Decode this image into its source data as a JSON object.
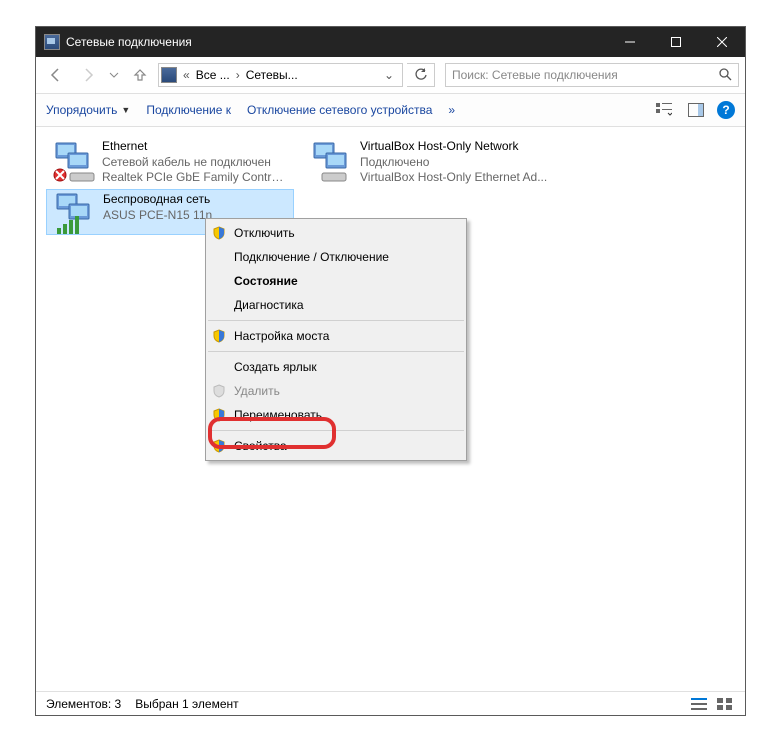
{
  "window": {
    "title": "Сетевые подключения",
    "breadcrumb": {
      "seg1": "Все ...",
      "seg2": "Сетевы..."
    },
    "search_placeholder": "Поиск: Сетевые подключения"
  },
  "toolbar": {
    "organize": "Упорядочить",
    "connect": "Подключение к",
    "disable": "Отключение сетевого устройства",
    "more": "»"
  },
  "adapters": {
    "ethernet": {
      "name": "Ethernet",
      "status": "Сетевой кабель не подключен",
      "device": "Realtek PCIe GbE Family Controller"
    },
    "virtualbox": {
      "name": "VirtualBox Host-Only Network",
      "status": "Подключено",
      "device": "VirtualBox Host-Only Ethernet Ad..."
    },
    "wireless": {
      "name": "Беспроводная сеть",
      "status": "",
      "device": "ASUS PCE-N15 11n"
    }
  },
  "context_menu": {
    "disable": "Отключить",
    "connect": "Подключение / Отключение",
    "status": "Состояние",
    "diagnose": "Диагностика",
    "bridge": "Настройка моста",
    "shortcut": "Создать ярлык",
    "delete": "Удалить",
    "rename": "Переименовать",
    "properties": "Свойства"
  },
  "statusbar": {
    "count": "Элементов: 3",
    "selection": "Выбран 1 элемент"
  }
}
